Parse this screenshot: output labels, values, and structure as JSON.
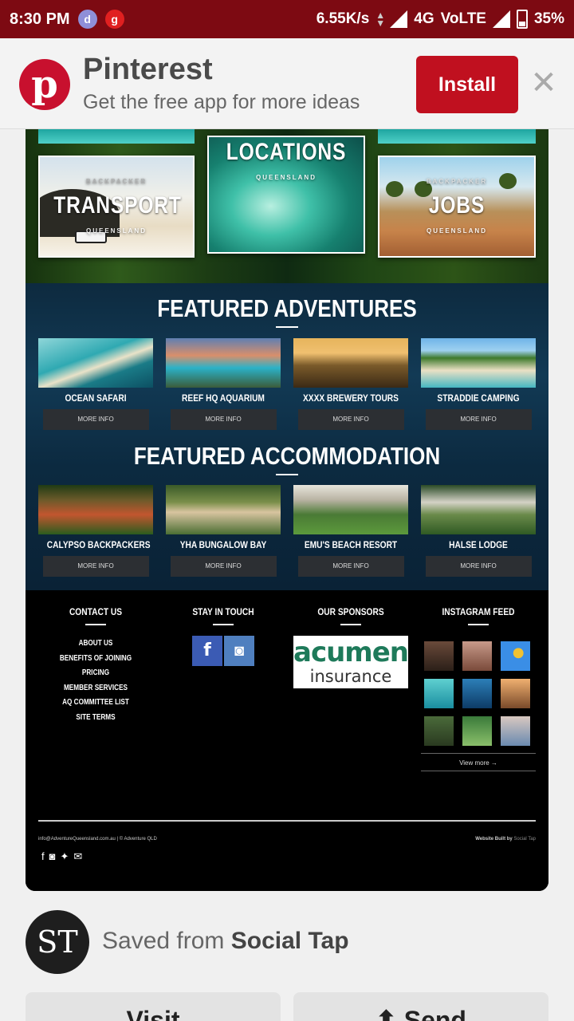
{
  "status_bar": {
    "time": "8:30 PM",
    "app_icon_1": "d",
    "app_icon_2": "g",
    "speed": "6.55K/s",
    "network": "4G",
    "volte": "VoLTE",
    "battery": "35%"
  },
  "banner": {
    "app_name": "Pinterest",
    "tagline": "Get the free app for more ideas",
    "install_label": "Install",
    "close_icon": "close-icon",
    "logo_letter": "p"
  },
  "pin": {
    "hero": {
      "transport": {
        "small": "BACKPACKER",
        "big": "TRANSPORT",
        "region": "QUEENSLAND"
      },
      "locations": {
        "big": "LOCATIONS",
        "region": "QUEENSLAND"
      },
      "jobs": {
        "small": "BACKPACKER",
        "big": "JOBS",
        "region": "QUEENSLAND"
      }
    },
    "adventures": {
      "title": "FEATURED ADVENTURES",
      "items": [
        {
          "name": "OCEAN SAFARI",
          "button": "MORE INFO"
        },
        {
          "name": "REEF HQ AQUARIUM",
          "button": "MORE INFO"
        },
        {
          "name": "XXXX BREWERY TOURS",
          "button": "MORE INFO"
        },
        {
          "name": "STRADDIE CAMPING",
          "button": "MORE INFO"
        }
      ]
    },
    "accommodation": {
      "title": "FEATURED ACCOMMODATION",
      "items": [
        {
          "name": "CALYPSO BACKPACKERS",
          "button": "MORE INFO"
        },
        {
          "name": "YHA BUNGALOW BAY",
          "button": "MORE INFO"
        },
        {
          "name": "EMU'S BEACH RESORT",
          "button": "MORE INFO"
        },
        {
          "name": "HALSE LODGE",
          "button": "MORE INFO"
        }
      ]
    },
    "footer": {
      "contact_title": "CONTACT US",
      "contact_links": [
        "ABOUT US",
        "BENEFITS OF JOINING",
        "PRICING",
        "MEMBER SERVICES",
        "AQ COMMITTEE LIST",
        "SITE TERMS"
      ],
      "stay_title": "STAY IN TOUCH",
      "sponsors_title": "OUR SPONSORS",
      "sponsor_line1": "acumen",
      "sponsor_line2": "insurance",
      "instagram_title": "INSTAGRAM FEED",
      "view_more": "View more →",
      "email_line": "info@AdventureQueensland.com.au | © Adventure QLD",
      "built_by": "Website Built by",
      "built_by_name": "Social Tap"
    }
  },
  "saved_from": {
    "avatar_text": "ST",
    "prefix": "Saved from",
    "source": "Social Tap"
  },
  "actions": {
    "visit_label": "Visit",
    "send_label": "Send"
  },
  "colors": {
    "status_bar": "#7d0a12",
    "pinterest_red": "#c0101f"
  }
}
